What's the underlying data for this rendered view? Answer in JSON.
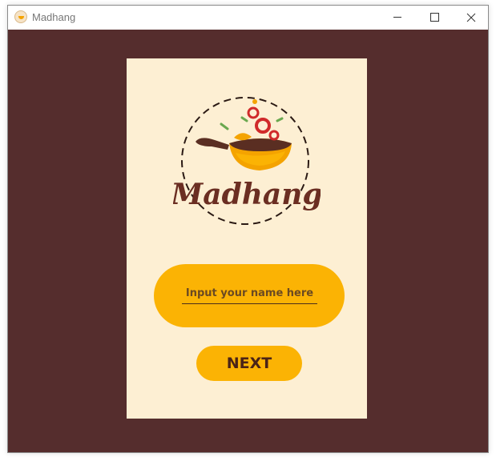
{
  "window": {
    "title": "Madhang",
    "icon": "madhang-app-icon"
  },
  "logo": {
    "wordmark": "Madhang",
    "icon": "cooking-pan-logo"
  },
  "form": {
    "name_placeholder": "Input your name here",
    "name_value": "",
    "next_label": "NEXT"
  },
  "colors": {
    "background": "#552d2d",
    "card": "#fdefd3",
    "accent": "#fbb304",
    "text_dark": "#4a2317"
  }
}
